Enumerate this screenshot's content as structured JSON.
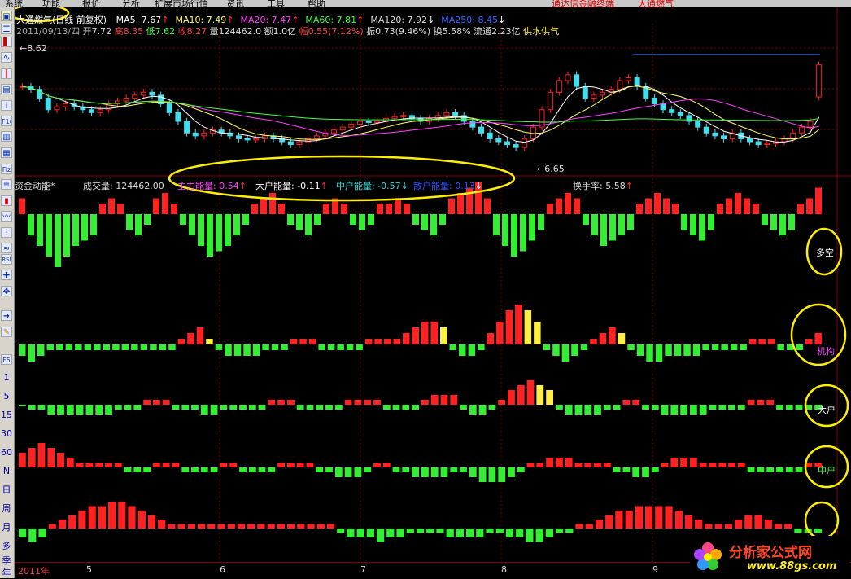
{
  "menu": {
    "items": [
      "系统",
      "功能",
      "报价",
      "分析",
      "扩展市场行情",
      "资讯",
      "工具",
      "帮助"
    ],
    "brand": "通达信金融终端",
    "stock": "大通燃气"
  },
  "toolbar": {
    "text_items": [
      "1",
      "5",
      "15",
      "30",
      "60",
      "N",
      "日",
      "周",
      "月",
      "多",
      "季",
      "年"
    ]
  },
  "header": {
    "title": "大通燃气(日线 前复权)",
    "ma": [
      {
        "label": "MA5: 7.67",
        "arrow": "↑",
        "color": "#ffffff"
      },
      {
        "label": "MA10: 7.49",
        "arrow": "↑",
        "color": "#ffff66"
      },
      {
        "label": "MA20: 7.47",
        "arrow": "↑",
        "color": "#ff44ff"
      },
      {
        "label": "MA60: 7.81",
        "arrow": "↑",
        "color": "#44ff44"
      },
      {
        "label": "MA120: 7.92",
        "arrow": "↓",
        "color": "#dddddd"
      },
      {
        "label": "MA250: 8.45",
        "arrow": "↓",
        "color": "#3366ff"
      }
    ],
    "quote": {
      "date": "2011/09/13/四",
      "open": "开7.72",
      "high": "高8.35",
      "low": "低7.62",
      "close": "收8.27",
      "volume": "量124462.0",
      "amount": "额1.0亿",
      "change": "幅0.55(7.12%)",
      "amplitude": "振0.73(9.46%)",
      "turnover": "换5.58%",
      "float": "流通2.23亿",
      "supply": "供水供气"
    },
    "price_high": "8.62",
    "price_low": "6.65"
  },
  "indicator": {
    "name": "资金动能*",
    "volume": "成交量: 124462.00",
    "main": "主力能量: 0.54",
    "big": "大户能量: -0.11",
    "mid": "中户能量: -0.57",
    "retail": "散户能量: 0.13",
    "turnover": "换手率: 5.58"
  },
  "panel_labels": {
    "duokong": "多空",
    "jigou": "机构",
    "dahu": "大户",
    "zhonghu": "中户"
  },
  "time_axis": [
    "2011年",
    "5",
    "6",
    "7",
    "8",
    "9"
  ],
  "watermark": {
    "title": "分析家公式网",
    "url": "www.88gs.com"
  },
  "colors": {
    "up": "#ff2222",
    "down": "#33ee33",
    "flat": "#ffee44",
    "panel_line": "#800000"
  },
  "chart_data": {
    "type": "candlestick-with-indicators",
    "x_range": [
      "2011-04",
      "2011-09-13"
    ],
    "price_ylim": [
      6.65,
      8.62
    ],
    "ma_values": {
      "MA5": 7.67,
      "MA10": 7.49,
      "MA20": 7.47,
      "MA60": 7.81,
      "MA120": 7.92,
      "MA250": 8.45
    },
    "last_bar": {
      "open": 7.72,
      "high": 8.35,
      "low": 7.62,
      "close": 8.27,
      "volume": 124462.0
    },
    "price_path": [
      7.9,
      7.85,
      7.7,
      7.5,
      7.55,
      7.6,
      7.55,
      7.5,
      7.45,
      7.5,
      7.6,
      7.65,
      7.7,
      7.75,
      7.8,
      7.75,
      7.6,
      7.45,
      7.3,
      7.1,
      7.05,
      7.1,
      7.15,
      7.1,
      7.05,
      7.0,
      6.98,
      7.0,
      7.05,
      7.0,
      6.95,
      6.9,
      6.95,
      7.0,
      7.05,
      7.1,
      7.15,
      7.2,
      7.25,
      7.3,
      7.28,
      7.3,
      7.35,
      7.38,
      7.4,
      7.35,
      7.3,
      7.35,
      7.4,
      7.45,
      7.4,
      7.3,
      7.2,
      7.1,
      7.0,
      6.95,
      6.9,
      6.85,
      7.0,
      7.2,
      7.5,
      7.8,
      8.0,
      8.1,
      7.9,
      7.7,
      7.75,
      7.8,
      7.85,
      8.0,
      8.05,
      7.9,
      7.7,
      7.6,
      7.5,
      7.45,
      7.4,
      7.3,
      7.2,
      7.1,
      7.05,
      7.0,
      7.1,
      7.0,
      6.95,
      6.9,
      6.92,
      6.95,
      7.0,
      7.1,
      7.2,
      7.3,
      8.27
    ],
    "duokong": [
      3,
      -4,
      -6,
      -8,
      -10,
      -8,
      -6,
      -5,
      -4,
      2,
      3,
      2,
      -3,
      -4,
      -2,
      3,
      4,
      2,
      -2,
      -4,
      -6,
      -8,
      -7,
      -6,
      -4,
      -2,
      2,
      3,
      4,
      2,
      -2,
      -3,
      -4,
      -2,
      2,
      3,
      2,
      -2,
      -3,
      -2,
      2,
      2,
      3,
      2,
      -2,
      -3,
      -4,
      -2,
      3,
      4,
      5,
      6,
      3,
      -4,
      -6,
      -8,
      -7,
      -5,
      -3,
      2,
      3,
      4,
      3,
      -2,
      -4,
      -6,
      -5,
      -4,
      -3,
      2,
      3,
      4,
      3,
      2,
      -3,
      -4,
      -5,
      -3,
      2,
      3,
      4,
      3,
      2,
      -2,
      -3,
      -4,
      -3,
      2,
      3,
      5
    ],
    "jigou": [
      -2,
      -3,
      -2,
      -1,
      -1,
      -1,
      -1,
      -1,
      -1,
      -1,
      -1,
      -1,
      -1,
      -1,
      -1,
      -1,
      -1,
      1,
      2,
      3,
      1,
      -1,
      -2,
      -2,
      -2,
      -2,
      -1,
      -1,
      -1,
      1,
      1,
      1,
      -1,
      -1,
      -1,
      -1,
      -1,
      1,
      1,
      1,
      1,
      2,
      3,
      4,
      4,
      3,
      -1,
      -2,
      -2,
      -1,
      2,
      4,
      6,
      7,
      6,
      4,
      -1,
      -2,
      -3,
      -2,
      -1,
      1,
      2,
      3,
      2,
      -1,
      -2,
      -3,
      -3,
      -2,
      -2,
      -2,
      -2,
      -1,
      -1,
      -1,
      -1,
      -1,
      1,
      1,
      1,
      -1,
      -1,
      -1,
      1,
      2
    ],
    "dahu": [
      0,
      -1,
      -1,
      -2,
      -2,
      -2,
      -2,
      -2,
      -2,
      -2,
      -1,
      -1,
      -1,
      1,
      1,
      1,
      -1,
      -1,
      -1,
      -2,
      -2,
      -1,
      -1,
      -1,
      -1,
      -1,
      1,
      1,
      1,
      -1,
      -1,
      -1,
      -1,
      -1,
      1,
      1,
      1,
      1,
      -1,
      -1,
      -1,
      -1,
      1,
      2,
      2,
      2,
      -1,
      -2,
      -2,
      -1,
      1,
      3,
      4,
      5,
      4,
      3,
      -1,
      -2,
      -2,
      -2,
      -2,
      -1,
      -1,
      1,
      1,
      -1,
      -1,
      -2,
      -2,
      -2,
      -2,
      -2,
      -1,
      -1,
      -1,
      -1,
      1,
      1,
      1,
      -1,
      -1,
      -1,
      -1,
      -1
    ],
    "zhonghu": [
      3,
      4,
      5,
      4,
      3,
      2,
      1,
      1,
      1,
      1,
      1,
      -1,
      -1,
      -1,
      1,
      1,
      1,
      -1,
      -1,
      -1,
      -1,
      1,
      1,
      -1,
      -1,
      -1,
      -1,
      1,
      1,
      1,
      1,
      -1,
      -1,
      -2,
      -2,
      -2,
      -1,
      1,
      1,
      -1,
      -1,
      -2,
      -2,
      -2,
      -2,
      -1,
      -1,
      -2,
      -3,
      -3,
      -3,
      -2,
      -1,
      1,
      1,
      2,
      2,
      2,
      1,
      1,
      1,
      1,
      -1,
      -1,
      -2,
      -2,
      -1,
      1,
      2,
      2,
      2,
      1,
      1,
      1,
      1,
      1,
      -1,
      -1,
      -1,
      -1,
      -1,
      -1,
      1,
      1
    ],
    "sanhu": [
      -2,
      -3,
      -2,
      1,
      2,
      3,
      4,
      5,
      5,
      6,
      6,
      5,
      4,
      3,
      2,
      1,
      1,
      1,
      1,
      1,
      1,
      1,
      1,
      1,
      1,
      1,
      1,
      1,
      1,
      1,
      1,
      1,
      -1,
      -2,
      -2,
      -2,
      -3,
      -2,
      -2,
      -1,
      -1,
      -1,
      -1,
      -2,
      -2,
      -2,
      -2,
      -1,
      -1,
      -2,
      -2,
      -3,
      -3,
      -2,
      -1,
      -1,
      1,
      1,
      2,
      3,
      4,
      4,
      5,
      5,
      5,
      5,
      4,
      3,
      2,
      1,
      1,
      1,
      2,
      3,
      3,
      2,
      1,
      1,
      -1,
      -1,
      -1
    ]
  }
}
